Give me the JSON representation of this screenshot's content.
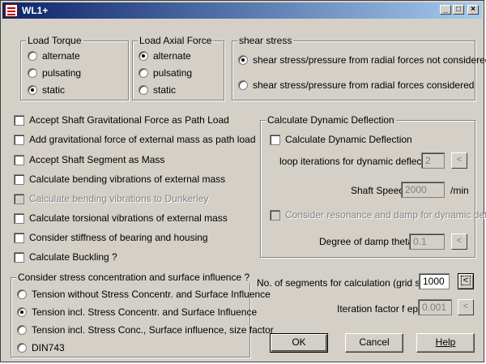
{
  "window": {
    "title": "WL1+"
  },
  "load_torque": {
    "title": "Load Torque",
    "options": [
      "alternate",
      "pulsating",
      "static"
    ],
    "selected": "static"
  },
  "load_axial": {
    "title": "Load Axial Force",
    "options": [
      "alternate",
      "pulsating",
      "static"
    ],
    "selected": "alternate"
  },
  "shear": {
    "title": "shear stress",
    "options": [
      "shear stress/pressure from radial forces not considered",
      "shear stress/pressure from radial forces considered"
    ],
    "selected": "shear stress/pressure from radial forces not considered"
  },
  "checkboxes": [
    {
      "label": "Accept Shaft Gravitational Force as Path Load",
      "checked": false,
      "enabled": true
    },
    {
      "label": "Add gravitational force of external mass as path load",
      "checked": false,
      "enabled": true
    },
    {
      "label": "Accept Shaft Segment as Mass",
      "checked": false,
      "enabled": true
    },
    {
      "label": "Calculate bending vibrations of external mass",
      "checked": false,
      "enabled": true
    },
    {
      "label": "Calculate bending vibrations to Dunkerley",
      "checked": false,
      "enabled": false
    },
    {
      "label": "Calculate torsional vibrations of external mass",
      "checked": false,
      "enabled": true
    },
    {
      "label": "Consider stiffness of bearing and housing",
      "checked": false,
      "enabled": true
    },
    {
      "label": "Calculate Buckling ?",
      "checked": false,
      "enabled": true
    }
  ],
  "dynamic": {
    "title": "Calculate Dynamic Deflection",
    "check_label": "Calculate Dynamic Deflection",
    "loop_label": "loop iterations for dynamic deflection",
    "loop_value": "2",
    "speed_label": "Shaft Speed",
    "speed_value": "2000",
    "speed_unit": "/min",
    "resonance_label": "Consider resonance and damp for dynamic defle",
    "damp_label": "Degree of damp theta",
    "damp_value": "0.1",
    "arrow": "<"
  },
  "stress": {
    "title": "Consider stress concentration and surface influence ?",
    "options": [
      "Tension without Stress Concentr. and Surface Influence",
      "Tension incl. Stress Concentr. and Surface Influence",
      "Tension incl. Stress Conc., Surface influence, size factor",
      "DIN743"
    ],
    "selected": "Tension incl. Stress Concentr. and Surface Influence"
  },
  "segments": {
    "label": "No. of segments for calculation (grid size)",
    "value": "1000",
    "arrow": "<"
  },
  "iteration": {
    "label": "Iteration factor f eps.",
    "value": "0.001",
    "arrow": "<"
  },
  "buttons": {
    "ok": "OK",
    "cancel": "Cancel",
    "help": "Help"
  },
  "titlebar_buttons": {
    "minimize": "_",
    "maximize": "□",
    "close": "×"
  }
}
